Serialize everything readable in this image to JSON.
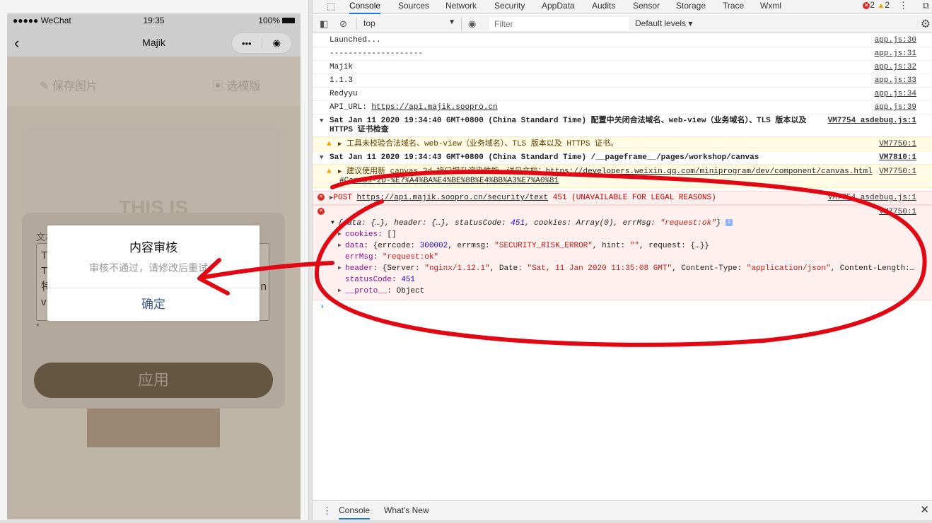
{
  "simulator": {
    "status_carrier": "●●●●● WeChat",
    "status_time": "19:35",
    "status_battery": "100%",
    "nav_title": "Majik",
    "back_glyph": "‹",
    "capsule_more": "•••",
    "capsule_close": "◉",
    "tools": [
      "保存图片",
      "选模版"
    ],
    "watermark": "THIS IS",
    "panel_label": "文本",
    "textarea_lines": [
      "T",
      "T",
      "特",
      "v"
    ],
    "textarea_right_char": "n",
    "tip_text": "* ",
    "apply_label": "应用",
    "modal": {
      "title": "内容审核",
      "content": "审核不通过，请修改后重试。",
      "confirm": "确定"
    }
  },
  "devtools": {
    "tabs": [
      "Console",
      "Sources",
      "Network",
      "Security",
      "AppData",
      "Audits",
      "Sensor",
      "Storage",
      "Trace",
      "Wxml"
    ],
    "active_tab": "Console",
    "error_count": "2",
    "warning_count": "2",
    "context": "top",
    "filter_placeholder": "Filter",
    "levels": "Default levels ▾",
    "logs": [
      {
        "text": "Launched...",
        "src": "app.js:30"
      },
      {
        "text": "--------------------",
        "src": "app.js:31"
      },
      {
        "text": "Majik",
        "src": "app.js:32"
      },
      {
        "text": "1.1.3",
        "src": "app.js:33"
      },
      {
        "text": "Redyyu",
        "src": "app.js:34"
      },
      {
        "prefix": "API_URL: ",
        "link": "https://api.majik.soopro.cn",
        "src": "app.js:39"
      }
    ],
    "group1": {
      "text": "Sat Jan 11 2020 19:34:40 GMT+0800 (China Standard Time) 配置中关闭合法域名、web-view（业务域名）、TLS 版本以及",
      "text2": "HTTPS 证书检查",
      "src": "VM7754 asdebug.js:1"
    },
    "warn1": {
      "text": "工具未校验合法域名、web-view（业务域名）、TLS 版本以及 HTTPS 证书。",
      "src": "VM7750:1"
    },
    "group2": {
      "text": "Sat Jan 11 2020 19:34:43 GMT+0800 (China Standard Time) /__pageframe__/pages/workshop/canvas",
      "src": "VM7810:1"
    },
    "warn2": {
      "prefix": "建议使用新 canvas 2d 接口提升渲染性能，详见文档：",
      "link": "https://developers.weixin.qq.com/miniprogram/dev/component/canvas.html",
      "link2": "#Canvas-2D-%E7%A4%BA%E4%BE%8B%E4%BB%A3%E7%A0%81",
      "src": "VM7750:1"
    },
    "error1": {
      "method": "POST ",
      "url": "https://api.majik.soopro.cn/security/text",
      "status": " 451 (UNAVAILABLE FOR LEGAL REASONS)",
      "src": "VM7754 asdebug.js:1"
    },
    "error2": {
      "src": "VM7750:1",
      "summary_a": "{data: {…}, header: {…}, statusCode: ",
      "summary_code": "451",
      "summary_b": ", cookies: Array(0), errMsg: ",
      "summary_msg": "\"request:ok\"",
      "summary_c": "}",
      "cookies_key": "cookies",
      "cookies_val": ": []",
      "data_key": "data",
      "data_a": ": {errcode: ",
      "data_code": "300002",
      "data_b": ", errmsg: ",
      "data_msg": "\"SECURITY_RISK_ERROR\"",
      "data_c": ", hint: ",
      "data_hint": "\"\"",
      "data_d": ", request: {…}}",
      "errmsg_key": "errMsg",
      "errmsg_val": "\"request:ok\"",
      "header_key": "header",
      "header_a": ": {Server: ",
      "header_server": "\"nginx/1.12.1\"",
      "header_b": ", Date: ",
      "header_date": "\"Sat, 11 Jan 2020 11:35:08 GMT\"",
      "header_c": ", Content-Type: ",
      "header_ct": "\"application/json\"",
      "header_d": ", Content-Length:…",
      "status_key": "statusCode",
      "status_val": "451",
      "proto_key": "__proto__",
      "proto_val": ": Object"
    },
    "drawer_tabs": [
      "Console",
      "What's New"
    ]
  }
}
